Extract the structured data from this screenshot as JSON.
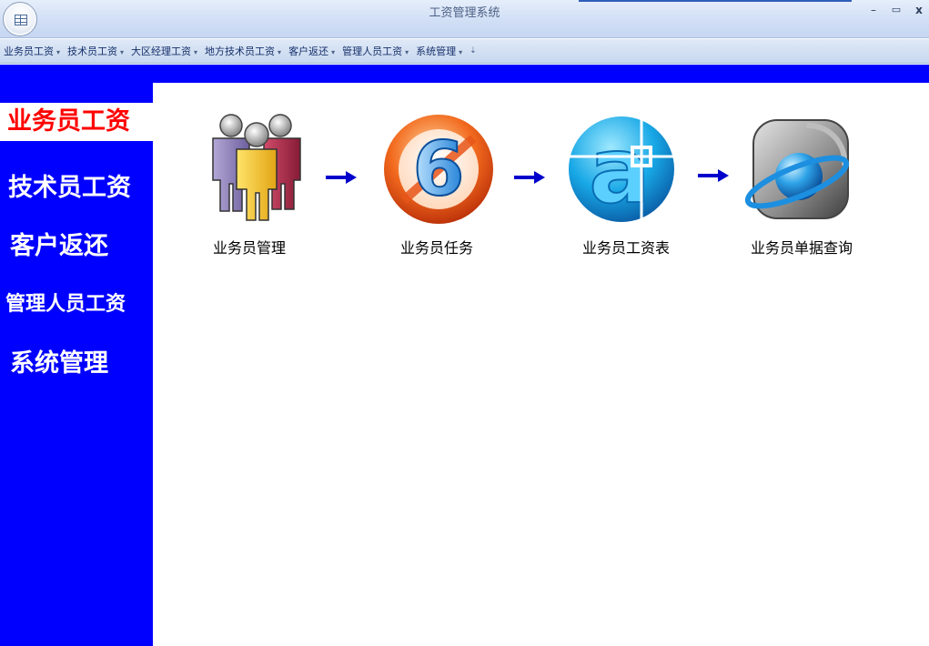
{
  "window": {
    "title": "工资管理系统",
    "minimize_label": "–",
    "maximize_label": "▭",
    "close_label": "x"
  },
  "menu": {
    "items": [
      {
        "label": "业务员工资"
      },
      {
        "label": "技术员工资"
      },
      {
        "label": "大区经理工资"
      },
      {
        "label": "地方技术员工资"
      },
      {
        "label": "客户返还"
      },
      {
        "label": "管理人员工资"
      },
      {
        "label": "系统管理"
      }
    ],
    "overflow_label": "⇣"
  },
  "sidebar": {
    "items": [
      {
        "label": "业务员工资",
        "active": true
      },
      {
        "label": "技术员工资",
        "active": false
      },
      {
        "label": "客户返还",
        "active": false
      },
      {
        "label": "管理人员工资",
        "active": false
      },
      {
        "label": "系统管理",
        "active": false
      }
    ]
  },
  "flow": {
    "steps": [
      {
        "label": "业务员管理",
        "icon": "users-group-icon"
      },
      {
        "label": "业务员任务",
        "icon": "number-six-icon"
      },
      {
        "label": "业务员工资表",
        "icon": "at-sign-crosshair-icon"
      },
      {
        "label": "业务员单据查询",
        "icon": "globe-orbit-icon"
      }
    ]
  },
  "colors": {
    "sidebar_bg": "#0000ff",
    "active_text": "#ff0000",
    "arrow": "#0000cc"
  }
}
